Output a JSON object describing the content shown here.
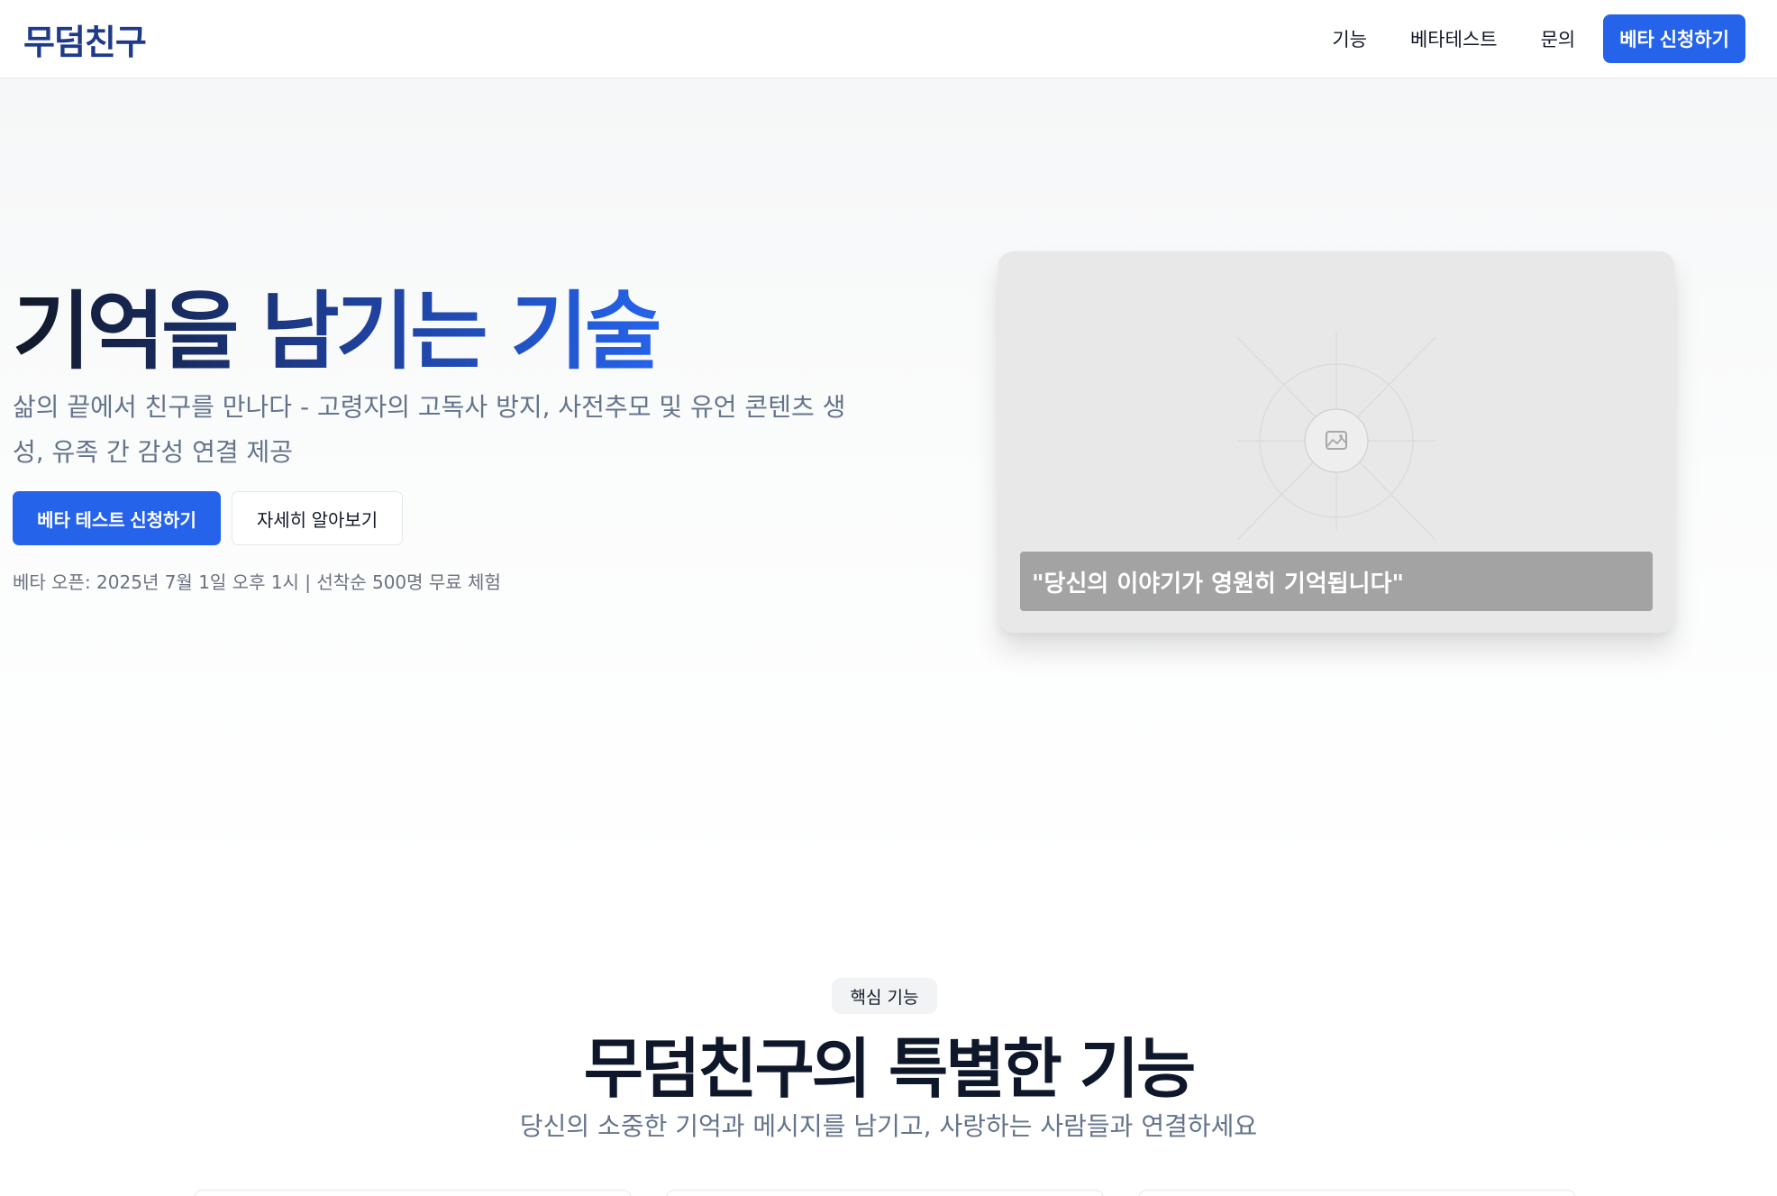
{
  "header": {
    "logo": "무덤친구",
    "nav": [
      {
        "label": "기능"
      },
      {
        "label": "베타테스트"
      },
      {
        "label": "문의"
      }
    ],
    "cta": "베타 신청하기"
  },
  "hero": {
    "title": "기억을 남기는 기술",
    "subtitle": "삶의 끝에서 친구를 만나다 - 고령자의 고독사 방지, 사전추모 및 유언 콘텐츠 생성, 유족 간 감성 연결 제공",
    "primary_button": "베타 테스트 신청하기",
    "secondary_button": "자세히 알아보기",
    "beta_note": "베타 오픈: 2025년 7월 1일 오후 1시 | 선착순 500명 무료 체험",
    "image_caption": "\"당신의 이야기가 영원히 기억됩니다\"",
    "image_icon": "image-icon"
  },
  "features": {
    "badge": "핵심 기능",
    "title": "무덤친구의 특별한 기능",
    "subtitle": "당신의 소중한 기억과 메시지를 남기고, 사랑하는 사람들과 연결하세요"
  },
  "colors": {
    "accent": "#2563eb",
    "brand_dark": "#1e3a8a",
    "text_muted": "#64748b"
  }
}
